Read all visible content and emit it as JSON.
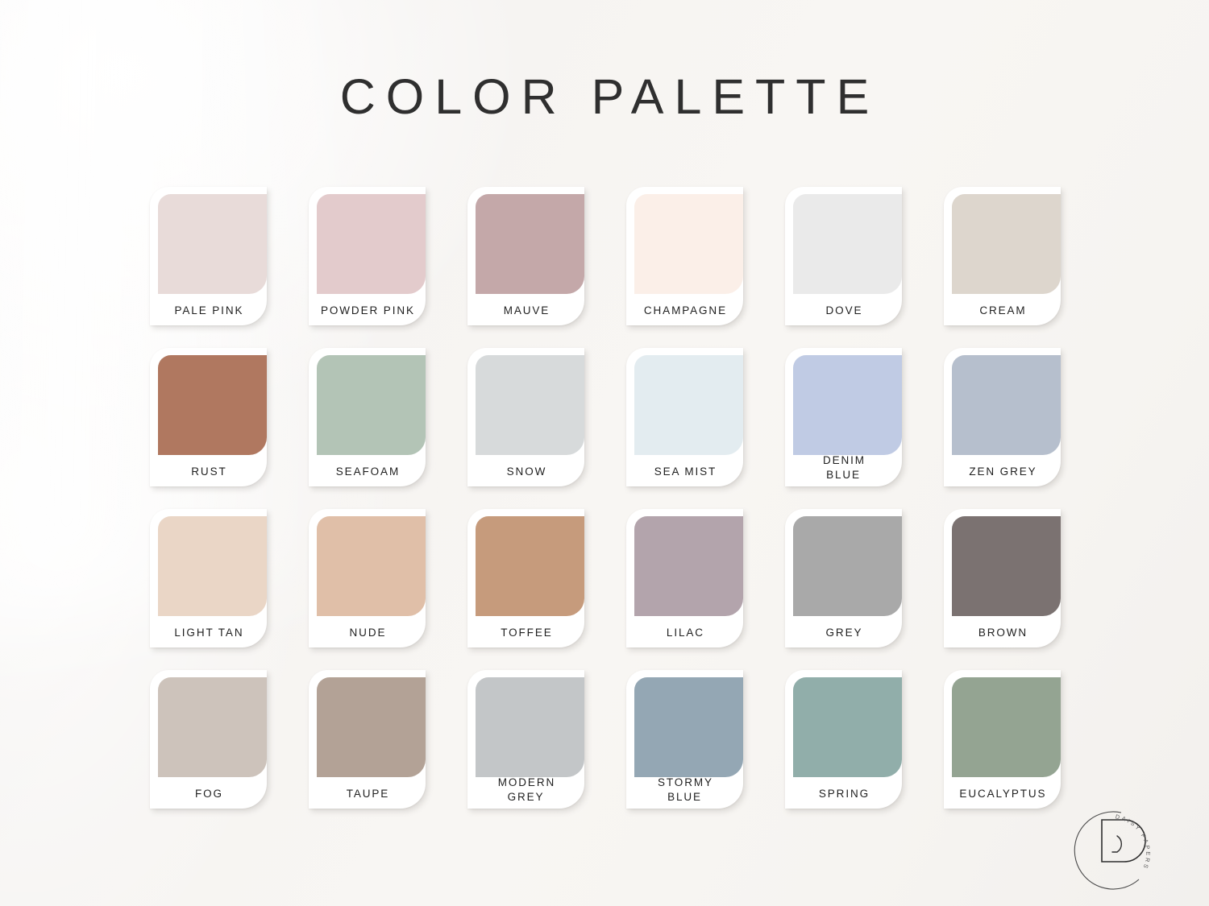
{
  "page": {
    "title": "COLOR PALETTE",
    "background_start": "#efedeb",
    "background_end": "#f8f6f3",
    "card_background": "#ffffff",
    "label_color": "#1f1f1f"
  },
  "brand": {
    "logo_name": "daisy-papers-logo",
    "monogram": "D",
    "curved_text": "DAISY PAPERS"
  },
  "palette": {
    "columns": 6,
    "rows": 4,
    "swatches": [
      {
        "name": "PALE PINK",
        "hex": "#e8dbd9",
        "lines": 1
      },
      {
        "name": "POWDER PINK",
        "hex": "#e3cbcc",
        "lines": 1
      },
      {
        "name": "MAUVE",
        "hex": "#c4a8a9",
        "lines": 1
      },
      {
        "name": "CHAMPAGNE",
        "hex": "#fbefe8",
        "lines": 1
      },
      {
        "name": "DOVE",
        "hex": "#eaeaea",
        "lines": 1
      },
      {
        "name": "CREAM",
        "hex": "#ddd6cd",
        "lines": 1
      },
      {
        "name": "RUST",
        "hex": "#b07860",
        "lines": 1
      },
      {
        "name": "SEAFOAM",
        "hex": "#b3c4b6",
        "lines": 1
      },
      {
        "name": "SNOW",
        "hex": "#d7dadb",
        "lines": 1
      },
      {
        "name": "SEA MIST",
        "hex": "#e3ecf0",
        "lines": 1
      },
      {
        "name": "DENIM BLUE",
        "hex": "#c0cbe4",
        "lines": 2
      },
      {
        "name": "ZEN GREY",
        "hex": "#b6bfcd",
        "lines": 1
      },
      {
        "name": "LIGHT TAN",
        "hex": "#ead6c6",
        "lines": 1
      },
      {
        "name": "NUDE",
        "hex": "#e0bfa8",
        "lines": 1
      },
      {
        "name": "TOFFEE",
        "hex": "#c69b7c",
        "lines": 1
      },
      {
        "name": "LILAC",
        "hex": "#b3a4ac",
        "lines": 1
      },
      {
        "name": "GREY",
        "hex": "#a9a9a9",
        "lines": 1
      },
      {
        "name": "BROWN",
        "hex": "#7b7271",
        "lines": 1
      },
      {
        "name": "FOG",
        "hex": "#cdc3bb",
        "lines": 1
      },
      {
        "name": "TAUPE",
        "hex": "#b3a296",
        "lines": 1
      },
      {
        "name": "MODERN GREY",
        "hex": "#c3c6c8",
        "lines": 2
      },
      {
        "name": "STORMY BLUE",
        "hex": "#94a7b4",
        "lines": 2
      },
      {
        "name": "SPRING",
        "hex": "#91aeaa",
        "lines": 1
      },
      {
        "name": "EUCALYPTUS",
        "hex": "#94a492",
        "lines": 1
      }
    ]
  }
}
